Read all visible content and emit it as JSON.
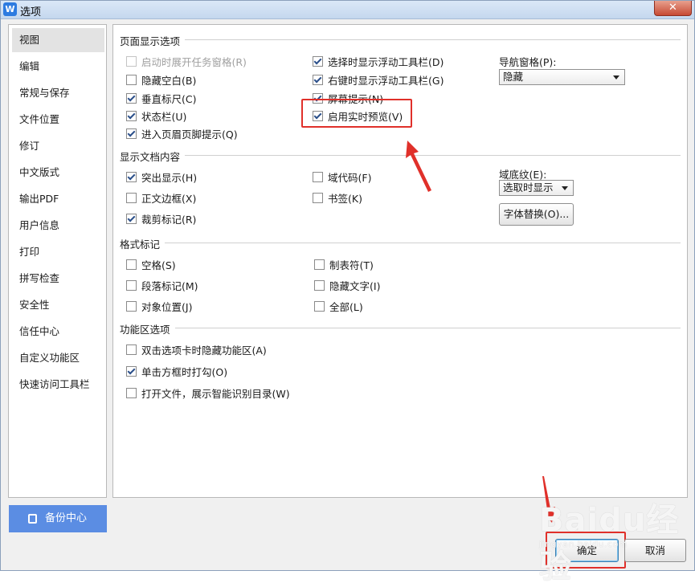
{
  "window": {
    "title": "选项",
    "app_icon": "W",
    "close": "✕"
  },
  "nav": {
    "items": [
      {
        "label": "视图",
        "active": true
      },
      {
        "label": "编辑"
      },
      {
        "label": "常规与保存"
      },
      {
        "label": "文件位置"
      },
      {
        "label": "修订"
      },
      {
        "label": "中文版式"
      },
      {
        "label": "输出PDF"
      },
      {
        "label": "用户信息"
      },
      {
        "label": "打印"
      },
      {
        "label": "拼写检查"
      },
      {
        "label": "安全性"
      },
      {
        "label": "信任中心"
      },
      {
        "label": "自定义功能区"
      },
      {
        "label": "快速访问工具栏"
      }
    ],
    "backup_label": "备份中心"
  },
  "page_display": {
    "title": "页面显示选项",
    "col1": [
      {
        "label": "启动时展开任务窗格(R)",
        "checked": false,
        "disabled": true
      },
      {
        "label": "隐藏空白(B)",
        "checked": false
      },
      {
        "label": "垂直标尺(C)",
        "checked": true
      },
      {
        "label": "状态栏(U)",
        "checked": true
      },
      {
        "label": "进入页眉页脚提示(Q)",
        "checked": true
      }
    ],
    "col2": [
      {
        "label": "选择时显示浮动工具栏(D)",
        "checked": true
      },
      {
        "label": "右键时显示浮动工具栏(G)",
        "checked": true
      },
      {
        "label": "屏幕提示(N)",
        "checked": true
      },
      {
        "label": "启用实时预览(V)",
        "checked": true
      }
    ],
    "nav_pane_label": "导航窗格(P):",
    "nav_pane_value": "隐藏"
  },
  "doc_content": {
    "title": "显示文档内容",
    "col1": [
      {
        "label": "突出显示(H)",
        "checked": true
      },
      {
        "label": "正文边框(X)",
        "checked": false
      },
      {
        "label": "裁剪标记(R)",
        "checked": true
      }
    ],
    "col2": [
      {
        "label": "域代码(F)",
        "checked": false
      },
      {
        "label": "书签(K)",
        "checked": false
      }
    ],
    "field_shading_label": "域底纹(E):",
    "field_shading_value": "选取时显示",
    "font_replace_label": "字体替换(O)..."
  },
  "format_marks": {
    "title": "格式标记",
    "col1": [
      {
        "label": "空格(S)",
        "checked": false
      },
      {
        "label": "段落标记(M)",
        "checked": false
      },
      {
        "label": "对象位置(J)",
        "checked": false
      }
    ],
    "col2": [
      {
        "label": "制表符(T)",
        "checked": false
      },
      {
        "label": "隐藏文字(I)",
        "checked": false
      },
      {
        "label": "全部(L)",
        "checked": false
      }
    ]
  },
  "ribbon": {
    "title": "功能区选项",
    "items": [
      {
        "label": "双击选项卡时隐藏功能区(A)",
        "checked": false
      },
      {
        "label": "单击方框时打勾(O)",
        "checked": true
      },
      {
        "label": "打开文件，展示智能识别目录(W)",
        "checked": false
      }
    ]
  },
  "footer": {
    "ok_label": "确定",
    "cancel_label": "取消"
  },
  "watermark": {
    "brand": "Baidu经验",
    "url": "jingyan.baidu.com"
  },
  "colors": {
    "highlight": "#e0302a",
    "backup_bg": "#5b8de3"
  }
}
